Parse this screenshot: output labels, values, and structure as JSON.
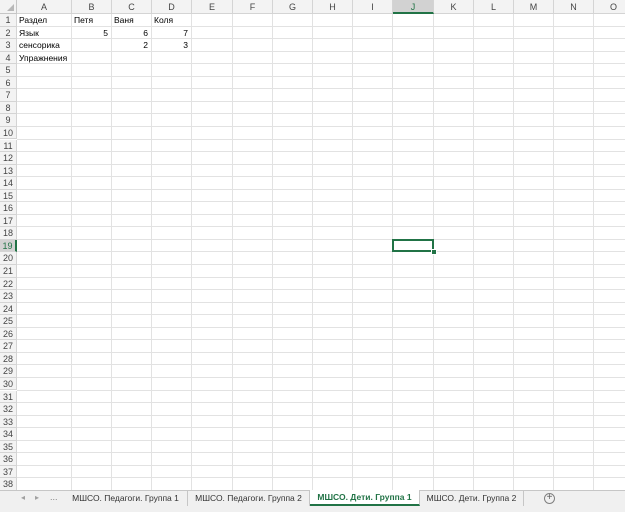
{
  "columns": [
    "A",
    "B",
    "C",
    "D",
    "E",
    "F",
    "G",
    "H",
    "I",
    "J",
    "K",
    "L",
    "M",
    "N",
    "O"
  ],
  "rows": [
    "1",
    "2",
    "3",
    "4",
    "5",
    "6",
    "7",
    "8",
    "9",
    "10",
    "11",
    "12",
    "13",
    "14",
    "15",
    "16",
    "17",
    "18",
    "19",
    "20",
    "21",
    "22",
    "23",
    "24",
    "25",
    "26",
    "27",
    "28",
    "29",
    "30",
    "31",
    "32",
    "33",
    "34",
    "35",
    "36",
    "37",
    "38"
  ],
  "cells": [
    {
      "ref": "A1",
      "value": "Раздел",
      "type": "text"
    },
    {
      "ref": "B1",
      "value": "Петя",
      "type": "text"
    },
    {
      "ref": "C1",
      "value": "Ваня",
      "type": "text"
    },
    {
      "ref": "D1",
      "value": "Коля",
      "type": "text"
    },
    {
      "ref": "A2",
      "value": "Язык",
      "type": "text"
    },
    {
      "ref": "B2",
      "value": "5",
      "type": "number"
    },
    {
      "ref": "C2",
      "value": "6",
      "type": "number"
    },
    {
      "ref": "D2",
      "value": "7",
      "type": "number"
    },
    {
      "ref": "A3",
      "value": "сенсорика",
      "type": "text"
    },
    {
      "ref": "C3",
      "value": "2",
      "type": "number"
    },
    {
      "ref": "D3",
      "value": "3",
      "type": "number"
    },
    {
      "ref": "A4",
      "value": "Упражнения",
      "type": "text"
    }
  ],
  "active_cell": "J19",
  "sheet_tabs": [
    {
      "label": "МШСО. Педагоги. Группа 1",
      "active": false
    },
    {
      "label": "МШСО. Педагоги. Группа 2",
      "active": false
    },
    {
      "label": "МШСО. Дети. Группа 1",
      "active": true
    },
    {
      "label": "МШСО. Дети. Группа 2",
      "active": false
    }
  ],
  "tab_nav": {
    "prev": "◂",
    "next": "▸",
    "more": "...",
    "add": "+"
  },
  "colors": {
    "accent": "#217346",
    "header_bg": "#f3f3f3",
    "gridline": "#e2e2e2"
  }
}
